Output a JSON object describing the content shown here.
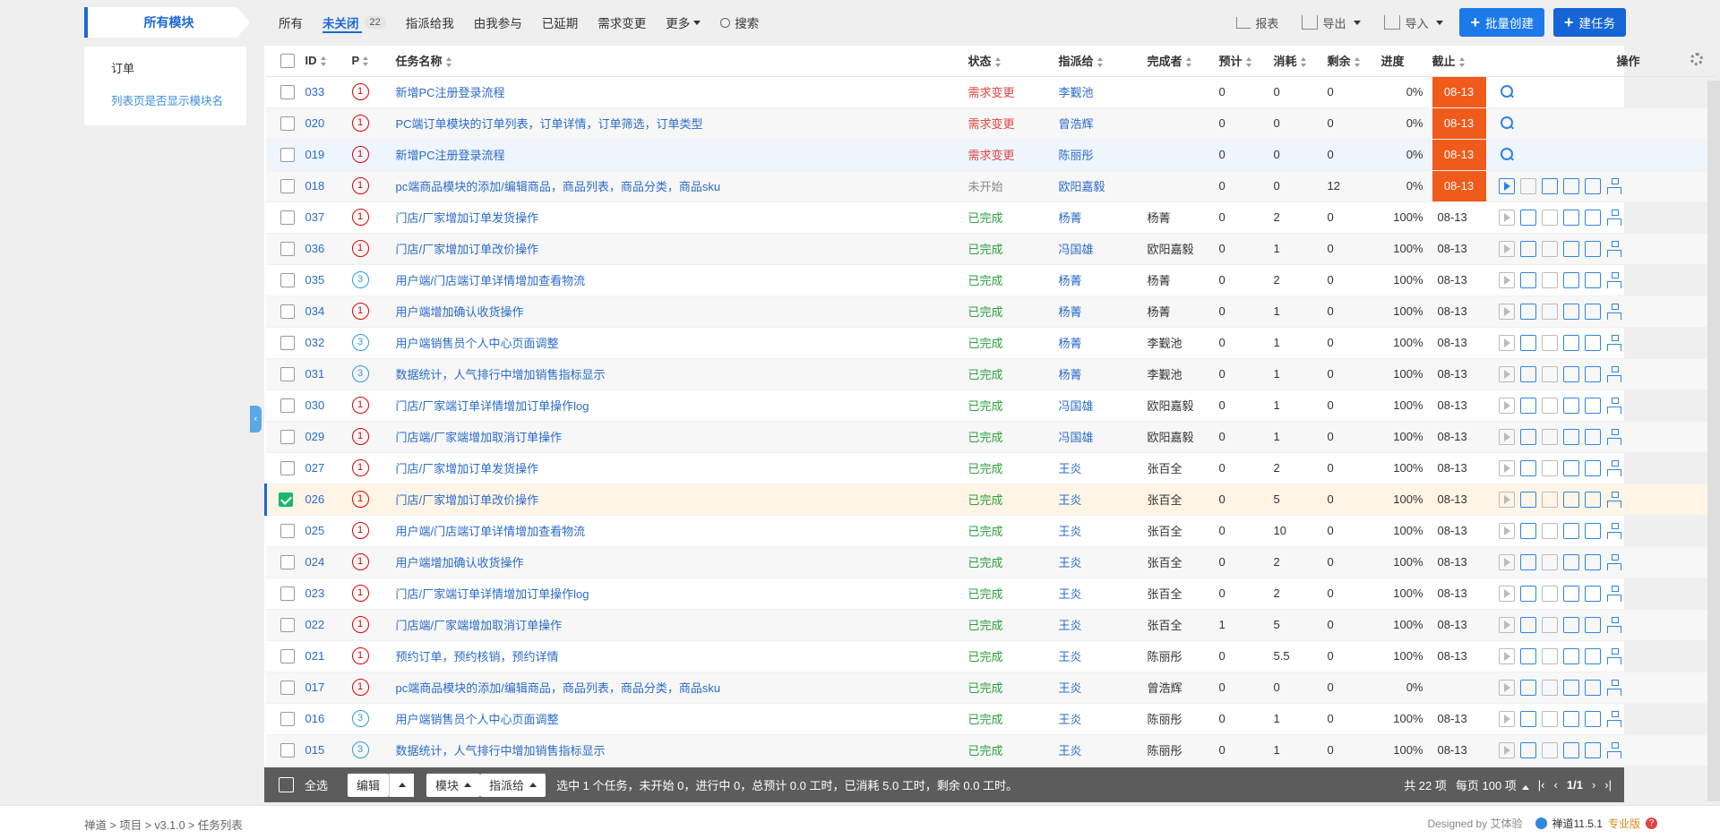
{
  "header": {
    "module_button": "所有模块",
    "tabs": [
      {
        "label": "所有"
      },
      {
        "label": "未关闭",
        "count": "22"
      },
      {
        "label": "指派给我"
      },
      {
        "label": "由我参与"
      },
      {
        "label": "已延期"
      },
      {
        "label": "需求变更"
      },
      {
        "label": "更多"
      },
      {
        "label": "搜索"
      }
    ],
    "report": "报表",
    "export": "导出",
    "import": "导入",
    "batch_create": "批量创建",
    "create_task": "建任务"
  },
  "sidebar": {
    "item": "订单",
    "link": "列表页是否显示模块名"
  },
  "table": {
    "columns": [
      "ID",
      "P",
      "任务名称",
      "状态",
      "指派给",
      "完成者",
      "预计",
      "消耗",
      "剩余",
      "进度",
      "截止",
      "操作"
    ],
    "rows": [
      {
        "id": "033",
        "p": "1",
        "name": "新增PC注册登录流程",
        "status": "需求变更",
        "assigned": "李觐池",
        "finisher": "",
        "est": "0",
        "used": "0",
        "left": "0",
        "progress": "0%",
        "deadline": "08-13"
      },
      {
        "id": "020",
        "p": "1",
        "name": "PC端订单模块的订单列表，订单详情，订单筛选，订单类型",
        "status": "需求变更",
        "assigned": "曾浩辉",
        "finisher": "",
        "est": "0",
        "used": "0",
        "left": "0",
        "progress": "0%",
        "deadline": "08-13"
      },
      {
        "id": "019",
        "p": "1",
        "name": "新增PC注册登录流程",
        "status": "需求变更",
        "assigned": "陈丽彤",
        "finisher": "",
        "est": "0",
        "used": "0",
        "left": "0",
        "progress": "0%",
        "deadline": "08-13"
      },
      {
        "id": "018",
        "p": "1",
        "name": "pc端商品模块的添加/编辑商品，商品列表，商品分类，商品sku",
        "status": "未开始",
        "assigned": "欧阳嘉毅",
        "finisher": "",
        "est": "0",
        "used": "0",
        "left": "12",
        "progress": "0%",
        "deadline": "08-13"
      },
      {
        "id": "037",
        "p": "1",
        "name": "门店/厂家增加订单发货操作",
        "status": "已完成",
        "assigned": "杨菁",
        "finisher": "杨菁",
        "est": "0",
        "used": "2",
        "left": "0",
        "progress": "100%",
        "deadline": "08-13"
      },
      {
        "id": "036",
        "p": "1",
        "name": "门店/厂家增加订单改价操作",
        "status": "已完成",
        "assigned": "冯国雄",
        "finisher": "欧阳嘉毅",
        "est": "0",
        "used": "1",
        "left": "0",
        "progress": "100%",
        "deadline": "08-13"
      },
      {
        "id": "035",
        "p": "3",
        "name": "用户端/门店端订单详情增加查看物流",
        "status": "已完成",
        "assigned": "杨菁",
        "finisher": "杨菁",
        "est": "0",
        "used": "2",
        "left": "0",
        "progress": "100%",
        "deadline": "08-13"
      },
      {
        "id": "034",
        "p": "1",
        "name": "用户端增加确认收货操作",
        "status": "已完成",
        "assigned": "杨菁",
        "finisher": "杨菁",
        "est": "0",
        "used": "1",
        "left": "0",
        "progress": "100%",
        "deadline": "08-13"
      },
      {
        "id": "032",
        "p": "3",
        "name": "用户端销售员个人中心页面调整",
        "status": "已完成",
        "assigned": "杨菁",
        "finisher": "李觐池",
        "est": "0",
        "used": "1",
        "left": "0",
        "progress": "100%",
        "deadline": "08-13"
      },
      {
        "id": "031",
        "p": "3",
        "name": "数据统计，人气排行中增加销售指标显示",
        "status": "已完成",
        "assigned": "杨菁",
        "finisher": "李觐池",
        "est": "0",
        "used": "1",
        "left": "0",
        "progress": "100%",
        "deadline": "08-13"
      },
      {
        "id": "030",
        "p": "1",
        "name": "门店/厂家端订单详情增加订单操作log",
        "status": "已完成",
        "assigned": "冯国雄",
        "finisher": "欧阳嘉毅",
        "est": "0",
        "used": "1",
        "left": "0",
        "progress": "100%",
        "deadline": "08-13"
      },
      {
        "id": "029",
        "p": "1",
        "name": "门店端/厂家端增加取消订单操作",
        "status": "已完成",
        "assigned": "冯国雄",
        "finisher": "欧阳嘉毅",
        "est": "0",
        "used": "1",
        "left": "0",
        "progress": "100%",
        "deadline": "08-13"
      },
      {
        "id": "027",
        "p": "1",
        "name": "门店/厂家增加订单发货操作",
        "status": "已完成",
        "assigned": "王炎",
        "finisher": "张百全",
        "est": "0",
        "used": "2",
        "left": "0",
        "progress": "100%",
        "deadline": "08-13"
      },
      {
        "id": "026",
        "p": "1",
        "name": "门店/厂家增加订单改价操作",
        "status": "已完成",
        "assigned": "王炎",
        "finisher": "张百全",
        "est": "0",
        "used": "5",
        "left": "0",
        "progress": "100%",
        "deadline": "08-13",
        "checked": true
      },
      {
        "id": "025",
        "p": "1",
        "name": "用户端/门店端订单详情增加查看物流",
        "status": "已完成",
        "assigned": "王炎",
        "finisher": "张百全",
        "est": "0",
        "used": "10",
        "left": "0",
        "progress": "100%",
        "deadline": "08-13"
      },
      {
        "id": "024",
        "p": "1",
        "name": "用户端增加确认收货操作",
        "status": "已完成",
        "assigned": "王炎",
        "finisher": "张百全",
        "est": "0",
        "used": "2",
        "left": "0",
        "progress": "100%",
        "deadline": "08-13"
      },
      {
        "id": "023",
        "p": "1",
        "name": "门店/厂家端订单详情增加订单操作log",
        "status": "已完成",
        "assigned": "王炎",
        "finisher": "张百全",
        "est": "0",
        "used": "2",
        "left": "0",
        "progress": "100%",
        "deadline": "08-13"
      },
      {
        "id": "022",
        "p": "1",
        "name": "门店端/厂家端增加取消订单操作",
        "status": "已完成",
        "assigned": "王炎",
        "finisher": "张百全",
        "est": "1",
        "used": "5",
        "left": "0",
        "progress": "100%",
        "deadline": "08-13"
      },
      {
        "id": "021",
        "p": "1",
        "name": "预约订单，预约核销，预约详情",
        "status": "已完成",
        "assigned": "王炎",
        "finisher": "陈丽彤",
        "est": "0",
        "used": "5.5",
        "left": "0",
        "progress": "100%",
        "deadline": "08-13"
      },
      {
        "id": "017",
        "p": "1",
        "name": "pc端商品模块的添加/编辑商品，商品列表，商品分类，商品sku",
        "status": "已完成",
        "assigned": "王炎",
        "finisher": "曾浩辉",
        "est": "0",
        "used": "0",
        "left": "0",
        "progress": "0%",
        "deadline": ""
      },
      {
        "id": "016",
        "p": "3",
        "name": "用户端销售员个人中心页面调整",
        "status": "已完成",
        "assigned": "王炎",
        "finisher": "陈丽彤",
        "est": "0",
        "used": "1",
        "left": "0",
        "progress": "100%",
        "deadline": "08-13"
      },
      {
        "id": "015",
        "p": "3",
        "name": "数据统计，人气排行中增加销售指标显示",
        "status": "已完成",
        "assigned": "王炎",
        "finisher": "陈丽彤",
        "est": "0",
        "used": "1",
        "left": "0",
        "progress": "100%",
        "deadline": "08-13"
      }
    ]
  },
  "footer_bar": {
    "select_all": "全选",
    "edit": "编辑",
    "module": "模块",
    "assign": "指派给",
    "summary": "选中 1 个任务，未开始 0，进行中 0，总预计 0.0 工时，已消耗 5.0 工时，剩余 0.0 工时。",
    "total": "共 22 项",
    "per_page": "每页 100 项",
    "page": "1/1"
  },
  "bottom": {
    "breadcrumb": "禅道 > 项目 > v3.1.0 > 任务列表",
    "designed_by": "Designed by 艾体验",
    "version": "禅道11.5.1",
    "edition": "专业版"
  }
}
